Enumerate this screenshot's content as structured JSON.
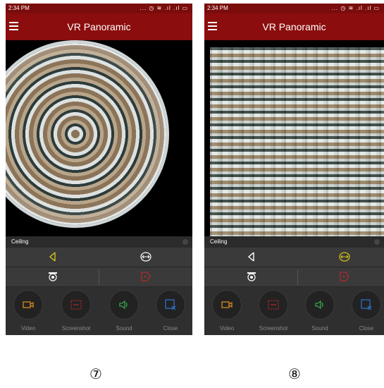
{
  "status": {
    "time": "2:34 PM",
    "icons": "... ◷ ≋ .ıl .ıl ▭"
  },
  "app_bar": {
    "title": "VR Panoramic"
  },
  "mode": {
    "label": "Ceiling"
  },
  "bottom_buttons": [
    {
      "label": "Video",
      "icon": "video-icon"
    },
    {
      "label": "Screenshot",
      "icon": "screenshot-icon"
    },
    {
      "label": "Sound",
      "icon": "sound-icon"
    },
    {
      "label": "Close",
      "icon": "close-icon"
    }
  ],
  "captions": {
    "left": "⑦",
    "right": "⑧"
  },
  "colors": {
    "app_bar": "#8b0d0d",
    "video_icon": "#d68a1e",
    "screenshot_icon": "#b02a2a",
    "sound_icon": "#37a44a",
    "close_icon": "#2f6fc4",
    "selected_ctrl": "#d4c21c",
    "record_icon": "#b02a2a"
  }
}
